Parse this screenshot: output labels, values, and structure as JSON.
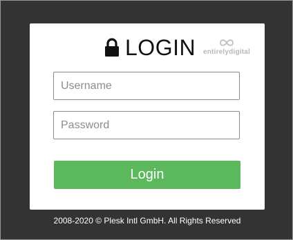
{
  "login_card": {
    "title": "LOGIN",
    "brand": {
      "name": "entirelydigital",
      "icon": "entirelydigital-logo"
    },
    "username_field": {
      "placeholder": "Username",
      "value": ""
    },
    "password_field": {
      "placeholder": "Password",
      "value": ""
    },
    "login_button_label": "Login",
    "lock_icon": "lock-icon"
  },
  "footer": {
    "copyright": "2008-2020 © Plesk Intl GmbH. All Rights Reserved"
  },
  "colors": {
    "background": "#333333",
    "card": "#ffffff",
    "button": "#5cb85c",
    "footer_text": "#ffffff"
  }
}
